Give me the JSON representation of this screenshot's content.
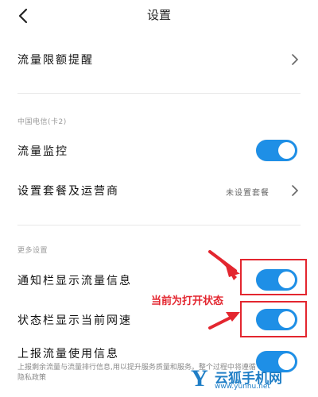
{
  "header": {
    "title": "设置"
  },
  "rows": {
    "flow_limit": {
      "label": "流量限额提醒"
    },
    "flow_monitor": {
      "label": "流量监控",
      "toggle_on": true
    },
    "package_setting": {
      "label": "设置套餐及运营商",
      "value": "未设置套餐"
    },
    "notify_flow": {
      "label": "通知栏显示流量信息",
      "toggle_on": true
    },
    "status_speed": {
      "label": "状态栏显示当前网速",
      "toggle_on": true
    },
    "report_usage": {
      "label": "上报流量使用信息",
      "toggle_on": true,
      "description": "上报剩余流量与流量排行信息,用以提升服务质量和服务。整个过程中将遵循隐私政策"
    }
  },
  "sections": {
    "carrier": "中国电信(卡2)",
    "more": "更多设置"
  },
  "annotation": {
    "text": "当前为打开状态"
  },
  "watermark": {
    "logo": "Y",
    "name": "云狐手机网",
    "url": "www.yunhu.net"
  },
  "colors": {
    "accent": "#1e8fe6",
    "annotation": "#e3262f",
    "watermark": "#1f7ec6"
  },
  "icons": {
    "back": "chevron-left-icon",
    "chevron": "chevron-right-icon"
  }
}
